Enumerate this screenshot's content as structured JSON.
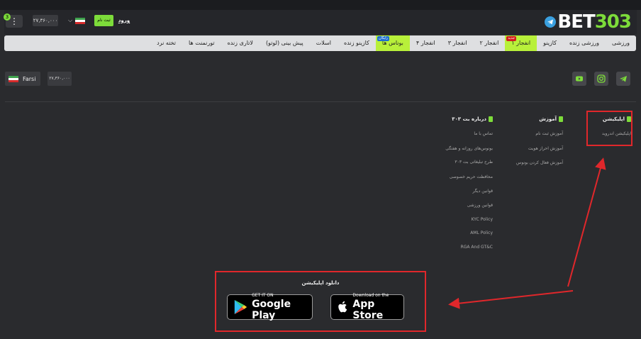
{
  "header": {
    "logo_prefix": "BET",
    "logo_number": "303",
    "login_label": "ورود",
    "register_label": "ثبت نام",
    "balance": "۲۷,۳۶۰,۰۰۰",
    "menu_badge": "3",
    "language_flag": "iran-flag"
  },
  "nav": {
    "items": [
      {
        "label": "ورزشی"
      },
      {
        "label": "ورزشی زنده"
      },
      {
        "label": "کازینو"
      },
      {
        "label": "انفجار ۱",
        "tag": "جدید"
      },
      {
        "label": "انفجار ۲"
      },
      {
        "label": "انفجار ۳"
      },
      {
        "label": "انفجار ۴"
      },
      {
        "label": "بوناس ها",
        "tag": "رایگان"
      },
      {
        "label": "کازینو زنده"
      },
      {
        "label": "اسلات"
      },
      {
        "label": "پیش بینی (لوتو)"
      },
      {
        "label": "لاتاری زنده"
      },
      {
        "label": "تورنمنت ها"
      },
      {
        "label": "تخته نرد"
      }
    ]
  },
  "toolbar": {
    "language_label": "Farsi",
    "balance": "۲۷,۳۶۰,۰۰۰",
    "social_icons": [
      "telegram-icon",
      "instagram-icon",
      "youtube-icon"
    ]
  },
  "footer": {
    "app": {
      "title": "اپلیکیشن",
      "links": [
        "اپلیکیشن اندروید"
      ]
    },
    "learning": {
      "title": "آموزش",
      "links": [
        "آموزش ثبت نام",
        "آموزش احراز هویت",
        "آموزش فعال کردن بونوس"
      ]
    },
    "about": {
      "title": "درباره بت ۳۰۳",
      "links": [
        "تماس با ما",
        "بونوس‌های روزانه و هفتگی",
        "طرح تبلیغاتی بت ۳۰۳",
        "محافظت حریم خصوصی",
        "قوانین دیگر",
        "قوانین ورزشی",
        "KYC Policy",
        "AML Policy",
        "RGA And GT&C"
      ]
    }
  },
  "download": {
    "title": "دانلود اپلیکیشن",
    "google_small": "GET IT ON",
    "google_big": "Google Play",
    "apple_small": "Download on the",
    "apple_big": "App Store"
  },
  "colors": {
    "accent": "#7ddc3a",
    "annotation": "#e0272b",
    "background": "#2a2b2e"
  }
}
